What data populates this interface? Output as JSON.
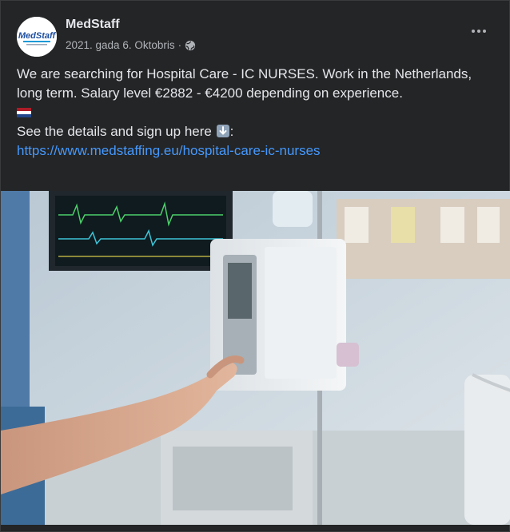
{
  "post": {
    "author": "MedStaff",
    "avatar_logo": "MedStaff",
    "date": "2021. gada 6. Oktobris",
    "separator": "·",
    "privacy_icon": "globe-icon",
    "more_icon": "more-options-icon",
    "text_line_1": "We are searching for Hospital Care - IC NURSES. Work in the Netherlands, long term. Salary level €2882 - €4200 depending on experience.",
    "text_line_3": "See the details and sign up here",
    "text_line_3_suffix": ":",
    "link": "https://www.medstaffing.eu/hospital-care-ic-nurses",
    "photo_icon": "hospital-photo"
  },
  "colors": {
    "background": "#242526",
    "text": "#e4e6eb",
    "secondary": "#b0b3b8",
    "link": "#4599ff"
  }
}
